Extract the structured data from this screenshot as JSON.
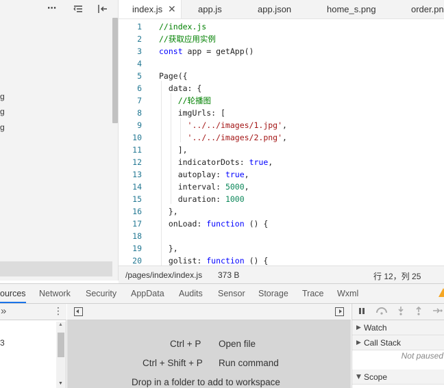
{
  "tree": {
    "fragments": [
      "g",
      "g",
      "g"
    ],
    "icons": [
      "more-icon",
      "collapse-all-icon",
      "toggle-sidebar-icon"
    ]
  },
  "editor": {
    "tabs": [
      {
        "label": "index.js",
        "active": true
      },
      {
        "label": "app.js"
      },
      {
        "label": "app.json"
      },
      {
        "label": "home_s.png"
      },
      {
        "label": "order.png"
      }
    ],
    "close_glyph": "✕",
    "lines": [
      {
        "n": "1",
        "t": [
          [
            "//index.js",
            "c-com"
          ]
        ]
      },
      {
        "n": "2",
        "t": [
          [
            "//获取应用实例",
            "c-com"
          ]
        ]
      },
      {
        "n": "3",
        "t": [
          [
            "const",
            "c-kw"
          ],
          [
            " app = getApp()",
            "c-def"
          ]
        ]
      },
      {
        "n": "4",
        "t": []
      },
      {
        "n": "5",
        "t": [
          [
            "Page({",
            "c-def"
          ]
        ]
      },
      {
        "n": "6",
        "t": [
          [
            "  data: {",
            "c-def"
          ]
        ]
      },
      {
        "n": "7",
        "t": [
          [
            "    //轮播图",
            "c-com"
          ]
        ]
      },
      {
        "n": "8",
        "t": [
          [
            "    imgUrls: [",
            "c-def"
          ]
        ]
      },
      {
        "n": "9",
        "t": [
          [
            "      ",
            "c-def"
          ],
          [
            "'../../images/1.jpg'",
            "c-str"
          ],
          [
            ",",
            "c-def"
          ]
        ]
      },
      {
        "n": "10",
        "t": [
          [
            "      ",
            "c-def"
          ],
          [
            "'../../images/2.png'",
            "c-str"
          ],
          [
            ",",
            "c-def"
          ]
        ]
      },
      {
        "n": "11",
        "t": [
          [
            "    ],",
            "c-def"
          ]
        ]
      },
      {
        "n": "12",
        "t": [
          [
            "    indicatorDots: ",
            "c-def"
          ],
          [
            "true",
            "c-kw"
          ],
          [
            ",",
            "c-def"
          ]
        ]
      },
      {
        "n": "13",
        "t": [
          [
            "    autoplay: ",
            "c-def"
          ],
          [
            "true",
            "c-kw"
          ],
          [
            ",",
            "c-def"
          ]
        ]
      },
      {
        "n": "14",
        "t": [
          [
            "    interval: ",
            "c-def"
          ],
          [
            "5000",
            "c-num"
          ],
          [
            ",",
            "c-def"
          ]
        ]
      },
      {
        "n": "15",
        "t": [
          [
            "    duration: ",
            "c-def"
          ],
          [
            "1000",
            "c-num"
          ]
        ]
      },
      {
        "n": "16",
        "t": [
          [
            "  },",
            "c-def"
          ]
        ]
      },
      {
        "n": "17",
        "t": [
          [
            "  onLoad: ",
            "c-def"
          ],
          [
            "function",
            "c-kw"
          ],
          [
            " () {",
            "c-def"
          ]
        ]
      },
      {
        "n": "18",
        "t": []
      },
      {
        "n": "19",
        "t": [
          [
            "  },",
            "c-def"
          ]
        ]
      },
      {
        "n": "20",
        "t": [
          [
            "  golist: ",
            "c-def"
          ],
          [
            "function",
            "c-kw"
          ],
          [
            " () {",
            "c-def"
          ]
        ]
      }
    ]
  },
  "status": {
    "path": "/pages/index/index.js",
    "size": "373 B",
    "position": "行 12，列 25"
  },
  "devtools": {
    "tabs": [
      "ources",
      "Network",
      "Security",
      "AppData",
      "Audits",
      "Sensor",
      "Storage",
      "Trace",
      "Wxml"
    ],
    "active_tab": "ources",
    "nav_chevron": "»",
    "nav_more": "⋮",
    "nav_fragment": "3",
    "shortcuts": [
      {
        "keys": "Ctrl + P",
        "action": "Open file"
      },
      {
        "keys": "Ctrl + Shift + P",
        "action": "Run command"
      }
    ],
    "drop_hint": "Drop in a folder to add to workspace",
    "debug": {
      "sections": [
        {
          "label": "Watch",
          "arrow": "▶"
        },
        {
          "label": "Call Stack",
          "arrow": "▶"
        },
        {
          "label": "Scope",
          "arrow": "▼"
        }
      ],
      "not_paused": "Not paused"
    }
  }
}
